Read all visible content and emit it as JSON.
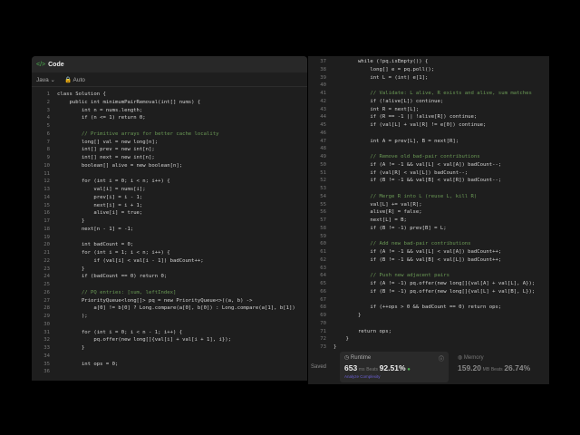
{
  "header": {
    "icon": "</>",
    "title": "Code"
  },
  "toolbar": {
    "language": "Java ⌄",
    "mode": "🔒 Auto"
  },
  "left_lines": [
    "class Solution {",
    "    public int minimumPairRemoval(int[] nums) {",
    "        int n = nums.length;",
    "        if (n <= 1) return 0;",
    "",
    "        // Primitive arrays for better cache locality",
    "        long[] val = new long[n];",
    "        int[] prev = new int[n];",
    "        int[] next = new int[n];",
    "        boolean[] alive = new boolean[n];",
    "",
    "        for (int i = 0; i < n; i++) {",
    "            val[i] = nums[i];",
    "            prev[i] = i - 1;",
    "            next[i] = i + 1;",
    "            alive[i] = true;",
    "        }",
    "        next[n - 1] = -1;",
    "",
    "        int badCount = 0;",
    "        for (int i = 1; i < n; i++) {",
    "            if (val[i] < val[i - 1]) badCount++;",
    "        }",
    "        if (badCount == 0) return 0;",
    "",
    "        // PQ entries: [sum, leftIndex]",
    "        PriorityQueue<long[]> pq = new PriorityQueue<>((a, b) ->",
    "            a[0] != b[0] ? Long.compare(a[0], b[0]) : Long.compare(a[1], b[1])",
    "        );",
    "",
    "        for (int i = 0; i < n - 1; i++) {",
    "            pq.offer(new long[]{val[i] + val[i + 1], i});",
    "        }",
    "",
    "        int ops = 0;",
    ""
  ],
  "right_lines": [
    "        while (!pq.isEmpty()) {",
    "            long[] e = pq.poll();",
    "            int L = (int) e[1];",
    "",
    "            // Validate: L alive, R exists and alive, sum matches",
    "            if (!alive[L]) continue;",
    "            int R = next[L];",
    "            if (R == -1 || !alive[R]) continue;",
    "            if (val[L] + val[R] != e[0]) continue;",
    "",
    "            int A = prev[L], B = next[R];",
    "",
    "            // Remove old bad-pair contributions",
    "            if (A != -1 && val[L] < val[A]) badCount--;",
    "            if (val[R] < val[L]) badCount--;",
    "            if (B != -1 && val[B] < val[R]) badCount--;",
    "",
    "            // Merge R into L (reuse L, kill R)",
    "            val[L] += val[R];",
    "            alive[R] = false;",
    "            next[L] = B;",
    "            if (B != -1) prev[B] = L;",
    "",
    "            // Add new bad-pair contributions",
    "            if (A != -1 && val[L] < val[A]) badCount++;",
    "            if (B != -1 && val[B] < val[L]) badCount++;",
    "",
    "            // Push new adjacent pairs",
    "            if (A != -1) pq.offer(new long[]{val[A] + val[L], A});",
    "            if (B != -1) pq.offer(new long[]{val[L] + val[B], L});",
    "",
    "            if (++ops > 0 && badCount == 0) return ops;",
    "        }",
    "",
    "        return ops;",
    "    }",
    "}"
  ],
  "status": {
    "saved": "Saved"
  },
  "runtime": {
    "label": "◷ Runtime",
    "value": "653",
    "unit": "ms",
    "beats_label": "Beats",
    "beats": "92.51%",
    "analyze": "Analyze Complexity"
  },
  "memory": {
    "label": "◍ Memory",
    "value": "159.20",
    "unit": "MB",
    "beats_label": "Beats",
    "beats": "26.74%"
  }
}
